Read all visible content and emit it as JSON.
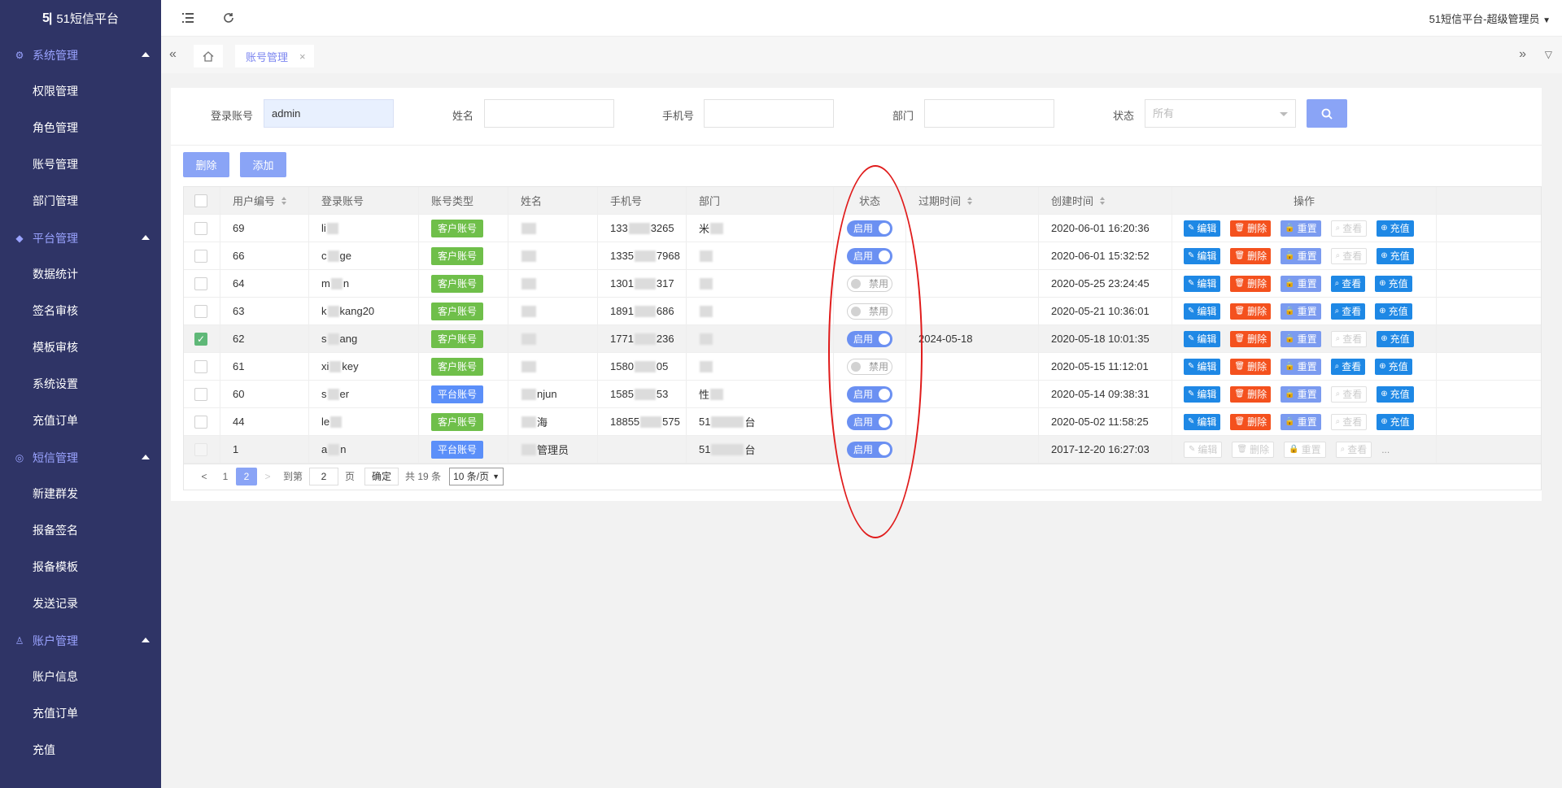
{
  "app": {
    "logo_mark": "5|",
    "title": "51短信平台"
  },
  "header": {
    "user_menu": "51短信平台-超级管理员"
  },
  "sidebar": {
    "groups": [
      {
        "label": "系统管理",
        "items": [
          "权限管理",
          "角色管理",
          "账号管理",
          "部门管理"
        ]
      },
      {
        "label": "平台管理",
        "items": [
          "数据统计",
          "签名审核",
          "模板审核",
          "系统设置",
          "充值订单"
        ]
      },
      {
        "label": "短信管理",
        "items": [
          "新建群发",
          "报备签名",
          "报备模板",
          "发送记录"
        ]
      },
      {
        "label": "账户管理",
        "items": [
          "账户信息",
          "充值订单",
          "充值"
        ]
      }
    ]
  },
  "tabs": {
    "active": "账号管理"
  },
  "filters": {
    "login_label": "登录账号",
    "login_value": "admin",
    "name_label": "姓名",
    "phone_label": "手机号",
    "dept_label": "部门",
    "status_label": "状态",
    "status_placeholder": "所有"
  },
  "toolbar": {
    "delete_label": "删除",
    "add_label": "添加"
  },
  "table": {
    "headers": [
      "用户编号",
      "登录账号",
      "账号类型",
      "姓名",
      "手机号",
      "部门",
      "状态",
      "过期时间",
      "创建时间",
      "操作"
    ],
    "ops": {
      "edit": "编辑",
      "delete": "删除",
      "reset": "重置",
      "view": "查看",
      "charge": "充值",
      "more": "..."
    },
    "status_on": "启用",
    "status_off": "禁用",
    "rows": [
      {
        "id": "69",
        "login_a": "li",
        "login_b": "",
        "type": "客户账号",
        "name_a": "",
        "name_b": "",
        "phone_a": "133",
        "phone_b": "3265",
        "dept_a": "米",
        "dept_b": "",
        "status": "on",
        "expire": "",
        "created": "2020-06-01 16:20:36",
        "view_enabled": false,
        "checked": false
      },
      {
        "id": "66",
        "login_a": "c",
        "login_b": "ge",
        "type": "客户账号",
        "name_a": "",
        "name_b": "",
        "phone_a": "1335",
        "phone_b": "7968",
        "dept_a": "",
        "dept_b": "",
        "status": "on",
        "expire": "",
        "created": "2020-06-01 15:32:52",
        "view_enabled": false,
        "checked": false
      },
      {
        "id": "64",
        "login_a": "m",
        "login_b": "n",
        "type": "客户账号",
        "name_a": "",
        "name_b": "",
        "phone_a": "1301",
        "phone_b": "317",
        "dept_a": "",
        "dept_b": "",
        "status": "off",
        "expire": "",
        "created": "2020-05-25 23:24:45",
        "view_enabled": true,
        "checked": false
      },
      {
        "id": "63",
        "login_a": "k",
        "login_b": "kang20",
        "type": "客户账号",
        "name_a": "",
        "name_b": "",
        "phone_a": "1891",
        "phone_b": "686",
        "dept_a": "",
        "dept_b": "",
        "status": "off",
        "expire": "",
        "created": "2020-05-21 10:36:01",
        "view_enabled": true,
        "checked": false
      },
      {
        "id": "62",
        "login_a": "s",
        "login_b": "ang",
        "type": "客户账号",
        "name_a": "",
        "name_b": "",
        "phone_a": "1771",
        "phone_b": "236",
        "dept_a": "",
        "dept_b": "",
        "status": "on",
        "expire": "2024-05-18",
        "created": "2020-05-18 10:01:35",
        "view_enabled": false,
        "checked": true
      },
      {
        "id": "61",
        "login_a": "xi",
        "login_b": "key",
        "type": "客户账号",
        "name_a": "",
        "name_b": "",
        "phone_a": "1580",
        "phone_b": "05",
        "dept_a": "",
        "dept_b": "",
        "status": "off",
        "expire": "",
        "created": "2020-05-15 11:12:01",
        "view_enabled": true,
        "checked": false
      },
      {
        "id": "60",
        "login_a": "s",
        "login_b": "er",
        "type": "平台账号",
        "name_a": "",
        "name_b": "njun",
        "phone_a": "1585",
        "phone_b": "53",
        "dept_a": "性",
        "dept_b": "",
        "status": "on",
        "expire": "",
        "created": "2020-05-14 09:38:31",
        "view_enabled": false,
        "checked": false
      },
      {
        "id": "44",
        "login_a": "le",
        "login_b": "",
        "type": "客户账号",
        "name_a": "",
        "name_b": "海",
        "phone_a": "18855",
        "phone_b": "575",
        "dept_a": "51",
        "dept_b": "台",
        "status": "on",
        "expire": "",
        "created": "2020-05-02 11:58:25",
        "view_enabled": false,
        "checked": false
      },
      {
        "id": "1",
        "login_a": "a",
        "login_b": "n",
        "type": "平台账号",
        "name_a": "",
        "name_b": "管理员",
        "phone_a": "",
        "phone_b": "",
        "dept_a": "51",
        "dept_b": "台",
        "status": "on",
        "expire": "",
        "created": "2017-12-20 16:27:03",
        "view_enabled": false,
        "checked": false,
        "all_disabled": true
      }
    ]
  },
  "pagination": {
    "pages": [
      "1",
      "2"
    ],
    "current": "2",
    "goto_label": "到第",
    "goto_value": "2",
    "page_unit": "页",
    "confirm": "确定",
    "total": "共 19 条",
    "page_size": "10 条/页"
  },
  "colors": {
    "sidebar": "#2f3466",
    "accent": "#8aa4f6",
    "annotation": "#e01b1b"
  }
}
